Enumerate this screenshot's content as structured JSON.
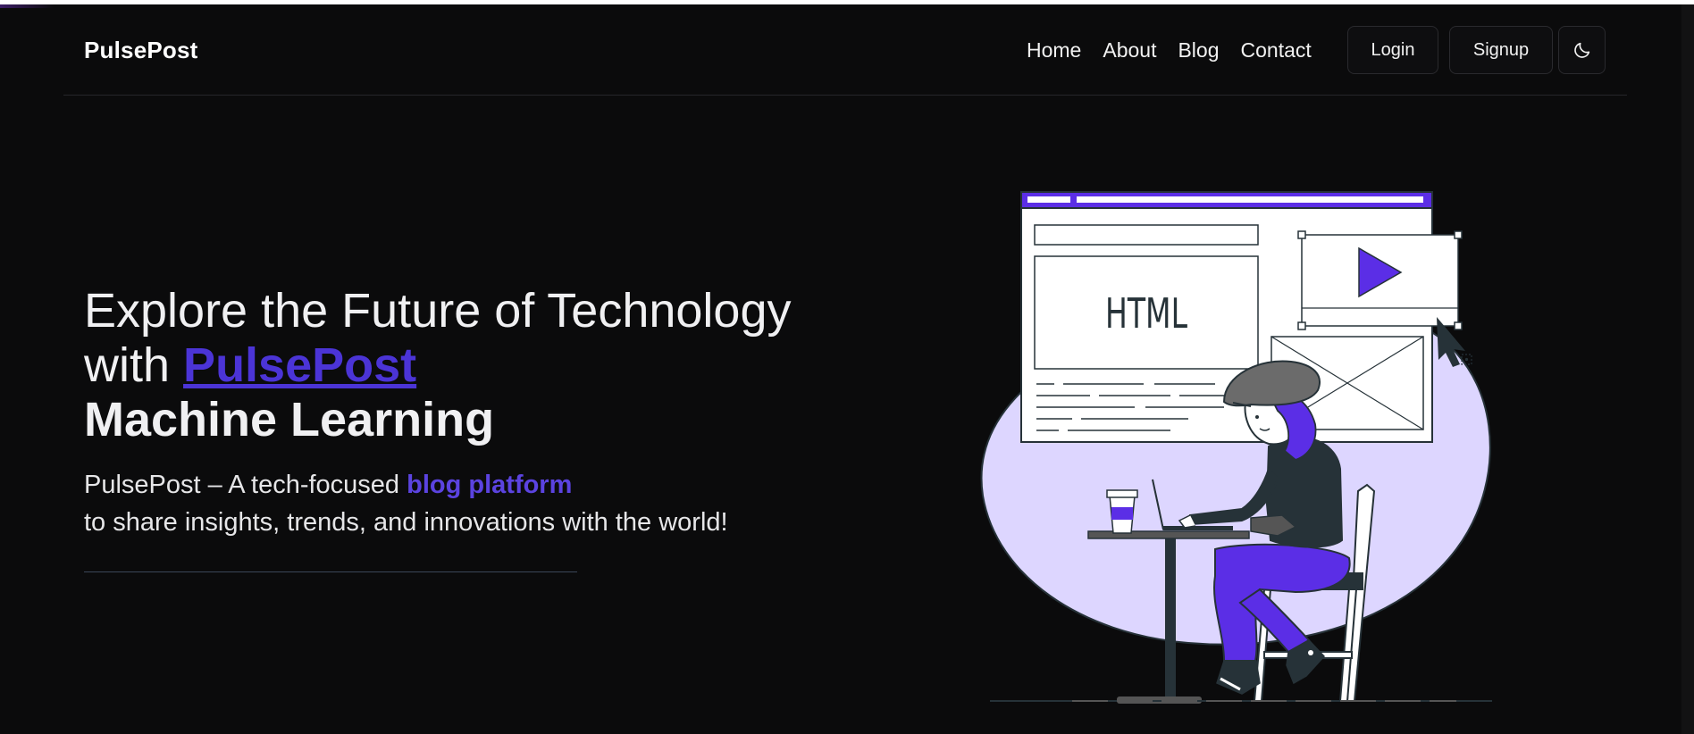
{
  "brand": {
    "name": "PulsePost"
  },
  "nav": {
    "links": [
      {
        "label": "Home"
      },
      {
        "label": "About"
      },
      {
        "label": "Blog"
      },
      {
        "label": "Contact"
      }
    ],
    "login_label": "Login",
    "signup_label": "Signup",
    "theme_icon": "moon-icon"
  },
  "hero": {
    "title_line1": "Explore the Future of Technology",
    "title_with": "with",
    "title_brand": "PulsePost",
    "rotating_text": "Machine Learning",
    "subtitle_part1": "PulsePost – A tech-focused",
    "subtitle_highlight": "blog platform",
    "subtitle_part2": "to share insights, trends, and innovations with the world!"
  },
  "illustration": {
    "html_label": "HTML",
    "colors": {
      "accent": "#5b2ee6",
      "blob": "#ddd6ff",
      "ink": "#263238"
    }
  }
}
